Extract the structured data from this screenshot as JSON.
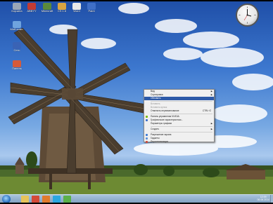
{
  "desktop": {
    "icons": [
      {
        "name": "icon-1",
        "label": "Корзина",
        "color": "#9aa7b8"
      },
      {
        "name": "icon-2",
        "label": "ABBYY",
        "color": "#c23b34"
      },
      {
        "name": "icon-3",
        "label": "Minecraft",
        "color": "#5b8a3a"
      },
      {
        "name": "icon-4",
        "label": "CS 1.6",
        "color": "#d9a441"
      },
      {
        "name": "icon-5",
        "label": "Word",
        "color": "#e8e8e8"
      },
      {
        "name": "icon-6",
        "label": "Paint",
        "color": "#3f6fc7"
      },
      {
        "name": "icon-7",
        "label": "Мой комп.",
        "color": "#6fa3de"
      },
      {
        "name": "icon-8",
        "label": "Сеть",
        "color": "#3a63b5"
      },
      {
        "name": "icon-9",
        "label": "Панель",
        "color": "#d55a3a"
      }
    ]
  },
  "context_menu": {
    "items": [
      {
        "label": "Вид",
        "type": "sub"
      },
      {
        "label": "Сортировка",
        "type": "sub"
      },
      {
        "label": "Обновить",
        "type": "highlight"
      },
      {
        "label": "",
        "type": "sep"
      },
      {
        "label": "Вставить",
        "type": "disabled"
      },
      {
        "label": "Вставить ярлык",
        "type": "disabled"
      },
      {
        "label": "Отменить переименование",
        "type": "normal",
        "shortcut": "CTRL+Z"
      },
      {
        "label": "",
        "type": "sep"
      },
      {
        "label": "Панель управления NVIDIA",
        "type": "icon",
        "icon_color": "#76b900"
      },
      {
        "label": "Графические характеристики...",
        "type": "icon",
        "icon_color": "#3d6fc9"
      },
      {
        "label": "Параметры графики",
        "type": "sub"
      },
      {
        "label": "",
        "type": "sep"
      },
      {
        "label": "Создать",
        "type": "sub"
      },
      {
        "label": "",
        "type": "sep"
      },
      {
        "label": "Разрешение экрана",
        "type": "icon",
        "icon_color": "#3f7cd4"
      },
      {
        "label": "Гаджеты",
        "type": "icon",
        "icon_color": "#5a8fd8"
      },
      {
        "label": "Персонализация",
        "type": "icon",
        "icon_color": "#c84a3b"
      }
    ]
  },
  "taskbar": {
    "buttons": [
      {
        "name": "explorer-button",
        "color": "#e6c35a"
      },
      {
        "name": "chrome-button",
        "color": "#d44a38"
      },
      {
        "name": "media-button",
        "color": "#e07b2c"
      },
      {
        "name": "skype-button",
        "color": "#2aa7e0"
      },
      {
        "name": "app-button",
        "color": "#5bb04a"
      }
    ],
    "time": "12:09",
    "date": "06.06.2014"
  },
  "colors": {
    "menu_highlight": "#2d5aa8",
    "taskbar": "#8fadcb"
  }
}
